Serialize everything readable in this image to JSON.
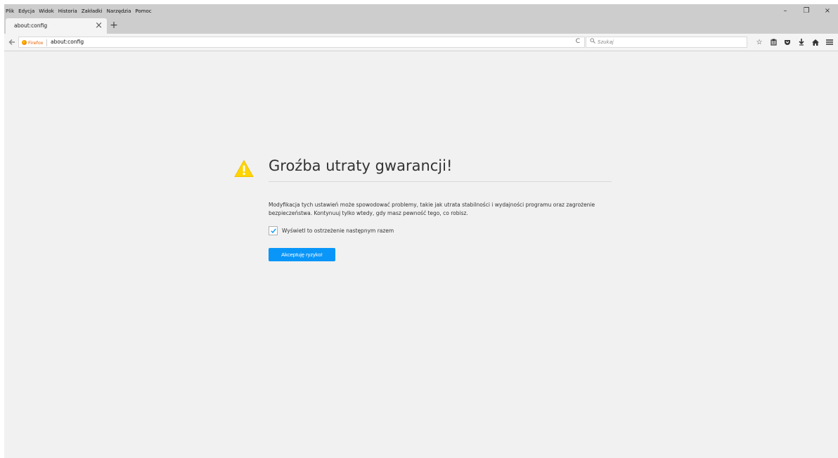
{
  "menubar": {
    "items": [
      "Plik",
      "Edycja",
      "Widok",
      "Historia",
      "Zakładki",
      "Narzędzia",
      "Pomoc"
    ]
  },
  "tab": {
    "title": "about:config",
    "close_glyph": "×",
    "new_tab_glyph": "+"
  },
  "window_controls": {
    "minimize": "–",
    "restore": "❐",
    "close": "×"
  },
  "navbar": {
    "identity_label": "Firefox",
    "url": "about:config",
    "reload_glyph": "C",
    "search_placeholder": "Szukaj",
    "icons": [
      "star-icon",
      "reading-list-icon",
      "pocket-icon",
      "download-icon",
      "home-icon",
      "menu-icon"
    ]
  },
  "warning": {
    "title": "Groźba utraty gwarancji!",
    "message": "Modyfikacja tych ustawień może spowodować problemy, takie jak utrata stabilności i wydajności programu oraz zagrożenie bezpieczeństwa. Kontynuuj tylko wtedy, gdy masz pewność tego, co robisz.",
    "checkbox_label": "Wyświetl to ostrzeżenie następnym razem",
    "checkbox_checked": true,
    "accept_button": "Akceptuję ryzyko!"
  },
  "colors": {
    "accent": "#0996f8",
    "warning_yellow": "#ffd400",
    "content_bg": "#f1f1f1",
    "chrome_bg": "#cdcdcd"
  }
}
